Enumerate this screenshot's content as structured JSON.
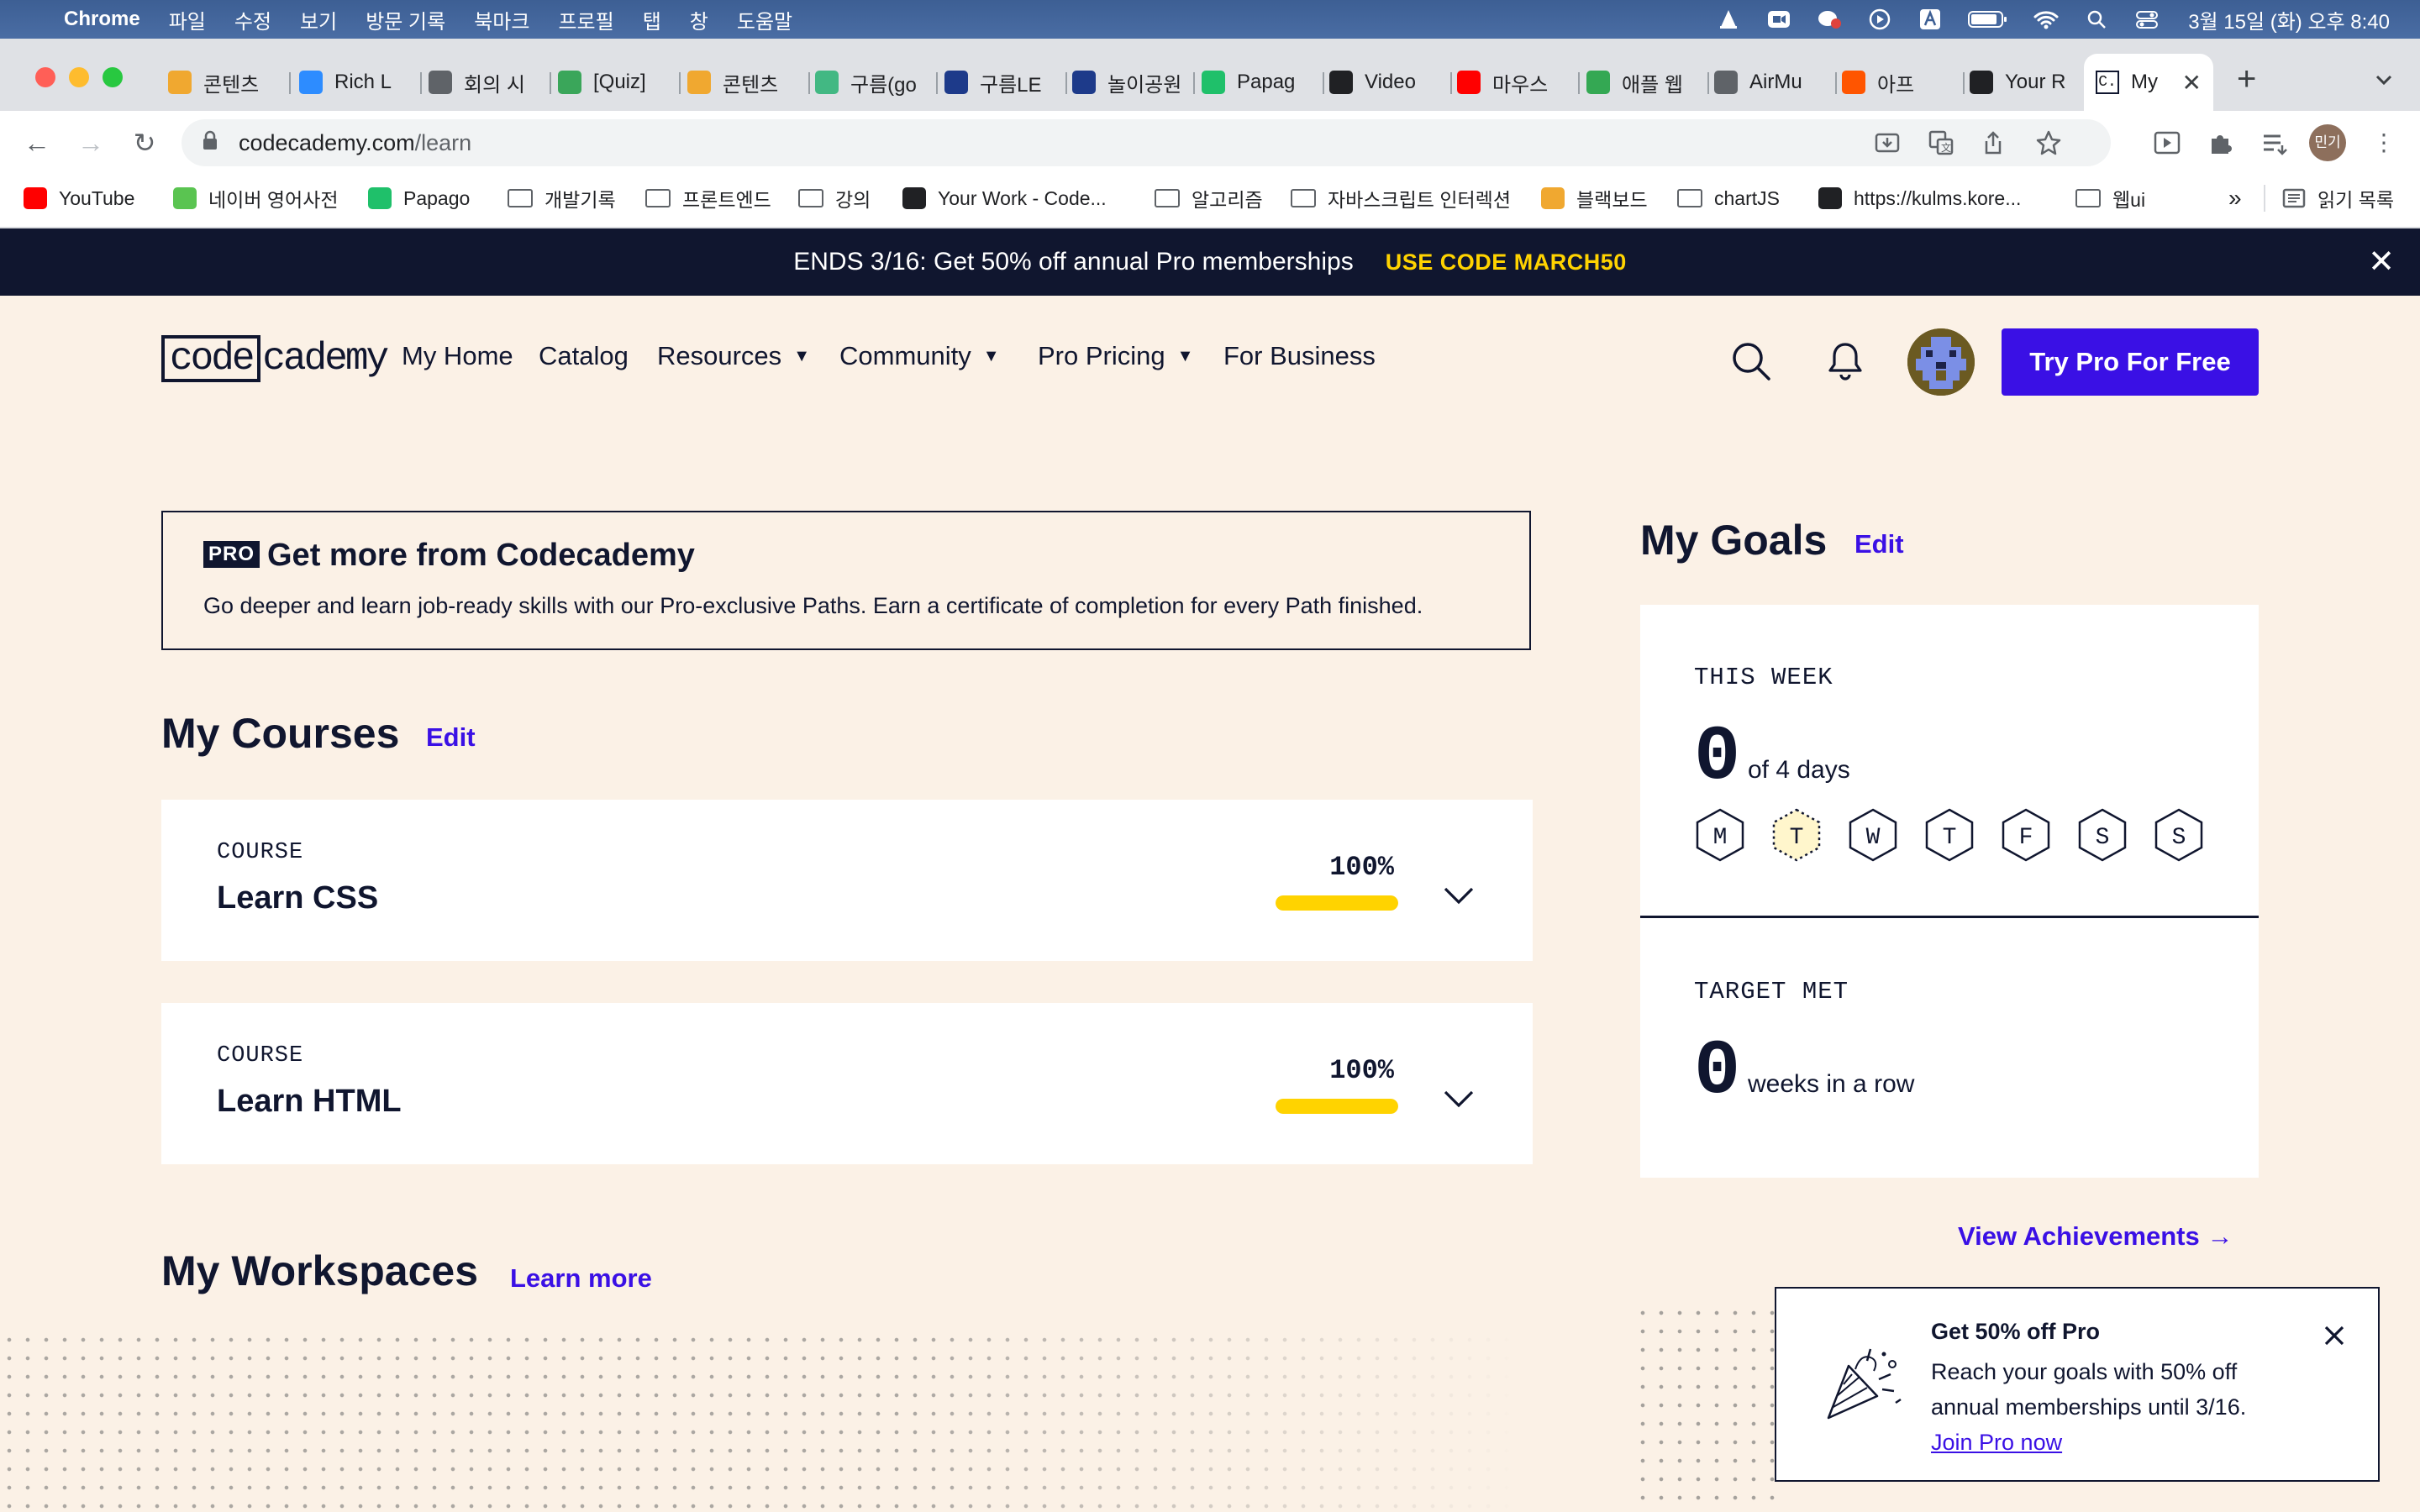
{
  "os": {
    "app": "Chrome",
    "menus": [
      "파일",
      "수정",
      "보기",
      "방문 기록",
      "북마크",
      "프로필",
      "탭",
      "창",
      "도움말"
    ],
    "clock": "3월 15일 (화) 오후 8:40",
    "status_icons": [
      "vlc-icon",
      "zoom-icon",
      "messenger-icon",
      "play-icon",
      "input-method-icon",
      "battery-icon",
      "wifi-icon",
      "spotlight-icon",
      "control-center-icon"
    ]
  },
  "browser": {
    "tabs": [
      {
        "label": "콘텐츠",
        "icon": "notes-icon",
        "color": "#f0a830"
      },
      {
        "label": "Rich L",
        "icon": "zoom-icon",
        "color": "#2d8cff"
      },
      {
        "label": "회의 시",
        "icon": "globe-icon",
        "color": "#5f6368"
      },
      {
        "label": "[Quiz]",
        "icon": "chat-icon",
        "color": "#3aa65a"
      },
      {
        "label": "콘텐츠",
        "icon": "notes-icon",
        "color": "#f0a830"
      },
      {
        "label": "구름(go",
        "icon": "v-icon",
        "color": "#42b883"
      },
      {
        "label": "구름LE",
        "icon": "arrow-icon",
        "color": "#1d3a8a"
      },
      {
        "label": "놀이공원",
        "icon": "arrow-icon",
        "color": "#1d3a8a"
      },
      {
        "label": "Papag",
        "icon": "papago-icon",
        "color": "#1fc06a"
      },
      {
        "label": "Video",
        "icon": "dots-icon",
        "color": "#202124"
      },
      {
        "label": "마우스",
        "icon": "youtube-icon",
        "color": "#ff0000"
      },
      {
        "label": "애플 웹",
        "icon": "green-q-icon",
        "color": "#34a853"
      },
      {
        "label": "AirMu",
        "icon": "airplay-icon",
        "color": "#5f6368"
      },
      {
        "label": "아프",
        "icon": "soundcloud-icon",
        "color": "#ff5500"
      },
      {
        "label": "Your R",
        "icon": "github-icon",
        "color": "#202124"
      }
    ],
    "active_tab": {
      "label": "My",
      "icon": "codecademy-icon"
    },
    "url_host": "codecademy.com",
    "url_path": "/learn",
    "bookmarks": [
      {
        "label": "YouTube",
        "icon": "youtube-icon"
      },
      {
        "label": "네이버 영어사전",
        "icon": "naver-dict-icon"
      },
      {
        "label": "Papago",
        "icon": "papago-icon"
      },
      {
        "label": "개발기록",
        "icon": "folder-icon"
      },
      {
        "label": "프론트엔드",
        "icon": "folder-icon"
      },
      {
        "label": "강의",
        "icon": "folder-icon"
      },
      {
        "label": "Your Work - Code...",
        "icon": "codepen-icon"
      },
      {
        "label": "알고리즘",
        "icon": "folder-icon"
      },
      {
        "label": "자바스크립트 인터렉션",
        "icon": "folder-icon"
      },
      {
        "label": "블랙보드",
        "icon": "pencil-icon"
      },
      {
        "label": "chartJS",
        "icon": "folder-icon"
      },
      {
        "label": "https://kulms.kore...",
        "icon": "blackboard-icon"
      },
      {
        "label": "웹ui",
        "icon": "folder-icon"
      }
    ],
    "overflow": "»",
    "reading_list": "읽기 목록",
    "profile_badge": "민기"
  },
  "banner": {
    "text": "ENDS 3/16: Get 50% off annual Pro memberships",
    "code": "USE CODE MARCH50"
  },
  "header": {
    "logo_boxed": "code",
    "logo_rest": "cademy",
    "nav": [
      {
        "label": "My Home",
        "dropdown": false
      },
      {
        "label": "Catalog",
        "dropdown": false
      },
      {
        "label": "Resources",
        "dropdown": true
      },
      {
        "label": "Community",
        "dropdown": true
      },
      {
        "label": "Pro Pricing",
        "dropdown": true
      },
      {
        "label": "For Business",
        "dropdown": false
      }
    ],
    "cta": "Try Pro For Free"
  },
  "pro_card": {
    "badge": "PRO",
    "title": "Get more from Codecademy",
    "description": "Go deeper and learn job-ready skills with our Pro-exclusive Paths. Earn a certificate of completion for every Path finished."
  },
  "courses": {
    "title": "My Courses",
    "edit": "Edit",
    "items": [
      {
        "kind": "COURSE",
        "name": "Learn CSS",
        "progress_label": "100%",
        "progress": 1.0
      },
      {
        "kind": "COURSE",
        "name": "Learn HTML",
        "progress_label": "100%",
        "progress": 1.0
      }
    ]
  },
  "workspaces": {
    "title": "My Workspaces",
    "link": "Learn more"
  },
  "goals": {
    "title": "My Goals",
    "edit": "Edit",
    "this_week_label": "THIS WEEK",
    "this_week_value": "0",
    "this_week_suffix": "of 4 days",
    "days": [
      "M",
      "T",
      "W",
      "T",
      "F",
      "S",
      "S"
    ],
    "current_day_index": 1,
    "target_label": "TARGET MET",
    "target_value": "0",
    "target_suffix": "weeks in a row",
    "achievements_link": "View Achievements →"
  },
  "toast": {
    "title": "Get 50% off Pro",
    "body": "Reach your goals with 50% off annual memberships until 3/16.",
    "link": "Join Pro now"
  }
}
